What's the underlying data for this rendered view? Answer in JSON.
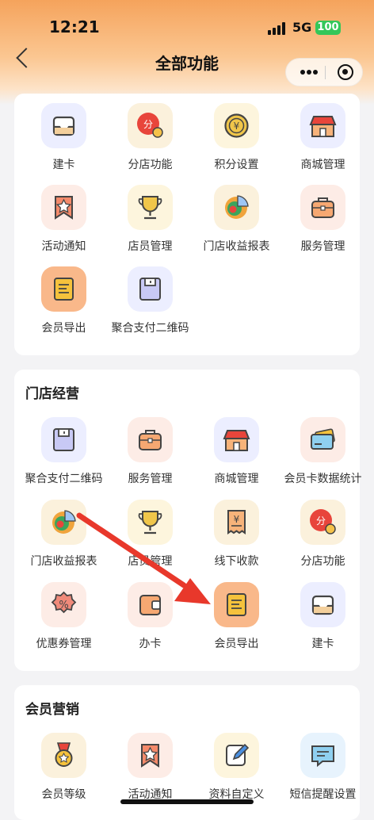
{
  "status_bar": {
    "time": "12:21",
    "network": "5G",
    "battery": "100"
  },
  "nav": {
    "title": "全部功能"
  },
  "sections": [
    {
      "title": "",
      "items": [
        {
          "label": "建卡",
          "icon": "inbox-tray-icon"
        },
        {
          "label": "分店功能",
          "icon": "branch-coin-icon"
        },
        {
          "label": "积分设置",
          "icon": "yuan-coin-icon"
        },
        {
          "label": "商城管理",
          "icon": "shop-icon"
        },
        {
          "label": "活动通知",
          "icon": "star-badge-icon"
        },
        {
          "label": "店员管理",
          "icon": "trophy-icon"
        },
        {
          "label": "门店收益报表",
          "icon": "pie-chart-icon"
        },
        {
          "label": "服务管理",
          "icon": "toolbox-icon"
        },
        {
          "label": "会员导出",
          "icon": "document-icon"
        },
        {
          "label": "聚合支付二维码",
          "icon": "floppy-icon"
        }
      ]
    },
    {
      "title": "门店经营",
      "items": [
        {
          "label": "聚合支付二维码",
          "icon": "floppy-icon"
        },
        {
          "label": "服务管理",
          "icon": "toolbox-icon"
        },
        {
          "label": "商城管理",
          "icon": "shop-icon"
        },
        {
          "label": "会员卡数据统计",
          "icon": "card-icon"
        },
        {
          "label": "门店收益报表",
          "icon": "pie-chart-icon"
        },
        {
          "label": "店员管理",
          "icon": "trophy-icon"
        },
        {
          "label": "线下收款",
          "icon": "receipt-icon"
        },
        {
          "label": "分店功能",
          "icon": "branch-coin-icon"
        },
        {
          "label": "优惠券管理",
          "icon": "coupon-icon"
        },
        {
          "label": "办卡",
          "icon": "wallet-icon"
        },
        {
          "label": "会员导出",
          "icon": "document-icon"
        },
        {
          "label": "建卡",
          "icon": "inbox-tray-icon"
        }
      ]
    },
    {
      "title": "会员营销",
      "items": [
        {
          "label": "会员等级",
          "icon": "medal-icon"
        },
        {
          "label": "活动通知",
          "icon": "star-badge-icon"
        },
        {
          "label": "资料自定义",
          "icon": "edit-icon"
        },
        {
          "label": "短信提醒设置",
          "icon": "message-icon"
        }
      ]
    }
  ],
  "colors": {
    "accent": "#f5a35c",
    "arrow": "#e8382b"
  }
}
